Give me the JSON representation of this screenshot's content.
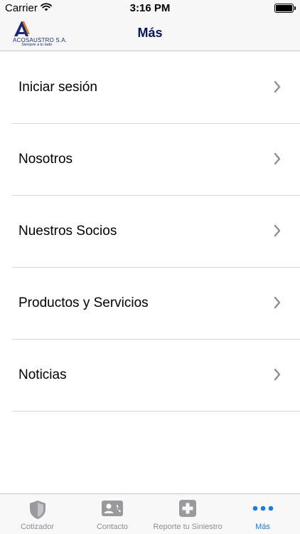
{
  "status_bar": {
    "carrier": "Carrier",
    "time": "3:16 PM",
    "battery_level": 1.0
  },
  "nav": {
    "title": "Más",
    "logo": {
      "name": "ACOSAUSTRO S.A.",
      "tagline": "Siempre a tu lado",
      "brand_color": "#1a2a7a"
    }
  },
  "menu": {
    "items": [
      {
        "label": "Iniciar sesión",
        "icon": "chevron-right-icon"
      },
      {
        "label": "Nosotros",
        "icon": "chevron-right-icon"
      },
      {
        "label": "Nuestros Socios",
        "icon": "chevron-right-icon"
      },
      {
        "label": "Productos y Servicios",
        "icon": "chevron-right-icon"
      },
      {
        "label": "Noticias",
        "icon": "chevron-right-icon"
      }
    ]
  },
  "tab_bar": {
    "active_color": "#1a7be0",
    "inactive_color": "#8e8e93",
    "tabs": [
      {
        "label": "Cotizador",
        "icon": "shield-icon",
        "active": false
      },
      {
        "label": "Contacto",
        "icon": "contact-card-icon",
        "active": false
      },
      {
        "label": "Reporte tu Siniestro",
        "icon": "medical-plus-icon",
        "active": false
      },
      {
        "label": "Más",
        "icon": "more-dots-icon",
        "active": true
      }
    ]
  }
}
